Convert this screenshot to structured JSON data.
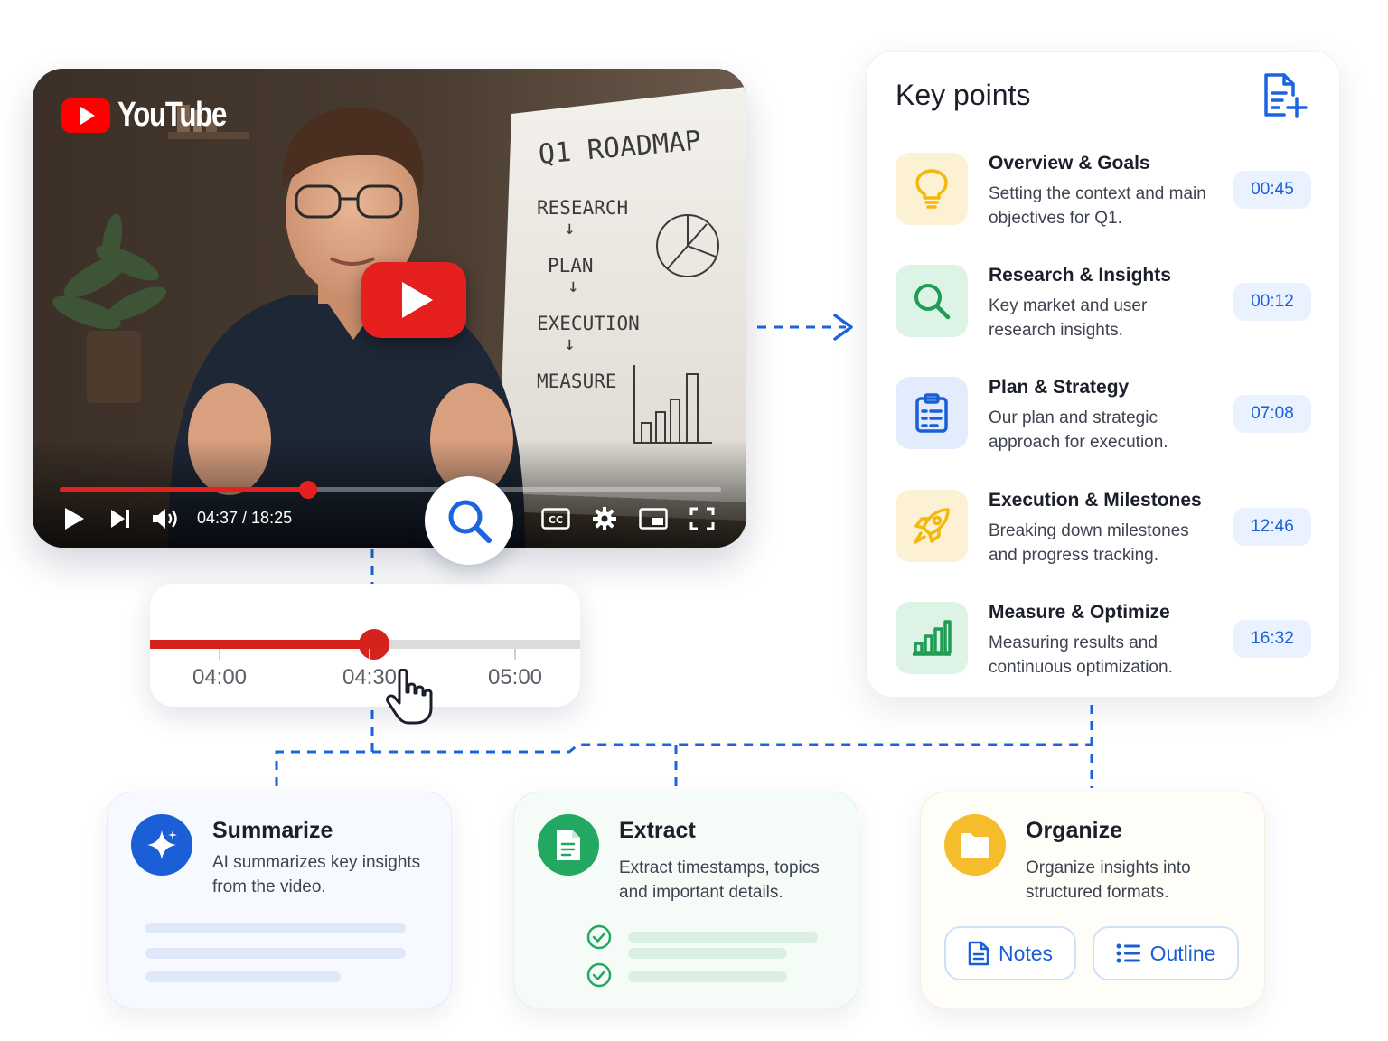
{
  "video": {
    "logo_text": "YouTube",
    "time": "04:37 / 18:25",
    "progress_fraction": 0.375,
    "whiteboard": {
      "title": "Q1 ROADMAP",
      "steps": [
        "RESEARCH",
        "PLAN",
        "EXECUTION",
        "MEASURE"
      ],
      "arrow": "↓"
    }
  },
  "scrubber": {
    "labels": [
      "04:00",
      "04:30",
      "05:00"
    ],
    "progress_fraction": 0.52
  },
  "key_points": {
    "title": "Key points",
    "items": [
      {
        "title": "Overview & Goals",
        "desc": "Setting the context and main objectives for Q1.",
        "time": "00:45",
        "icon": "lightbulb-icon",
        "icon_bg": "#fdf1d4",
        "icon_color": "#f2b80c"
      },
      {
        "title": "Research & Insights",
        "desc": "Key market and user research insights.",
        "time": "00:12",
        "icon": "search-icon",
        "icon_bg": "#ddf3e6",
        "icon_color": "#1f9d55"
      },
      {
        "title": "Plan & Strategy",
        "desc": "Our plan and strategic approach for execution.",
        "time": "07:08",
        "icon": "clipboard-icon",
        "icon_bg": "#e3ecfc",
        "icon_color": "#1a5fd6"
      },
      {
        "title": "Execution & Milestones",
        "desc": "Breaking down milestones and progress tracking.",
        "time": "12:46",
        "icon": "rocket-icon",
        "icon_bg": "#fdf1d4",
        "icon_color": "#f2b80c"
      },
      {
        "title": "Measure & Optimize",
        "desc": "Measuring results and continuous optimization.",
        "time": "16:32",
        "icon": "bar-chart-icon",
        "icon_bg": "#ddf3e6",
        "icon_color": "#1f9d55"
      }
    ]
  },
  "cards": {
    "summarize": {
      "title": "Summarize",
      "desc": "AI summarizes key insights from the video.",
      "icon": "sparkle-icon",
      "color": "#1a5fd6"
    },
    "extract": {
      "title": "Extract",
      "desc": "Extract timestamps, topics and important details.",
      "icon": "document-icon",
      "color": "#22a861"
    },
    "organize": {
      "title": "Organize",
      "desc": "Organize insights into structured formats.",
      "icon": "folder-icon",
      "color": "#f5bd2c",
      "buttons": [
        "Notes",
        "Outline"
      ]
    }
  },
  "colors": {
    "accent": "#1a5fd6",
    "youtube_red": "#e5201e",
    "connector": "#1a5fd6"
  }
}
